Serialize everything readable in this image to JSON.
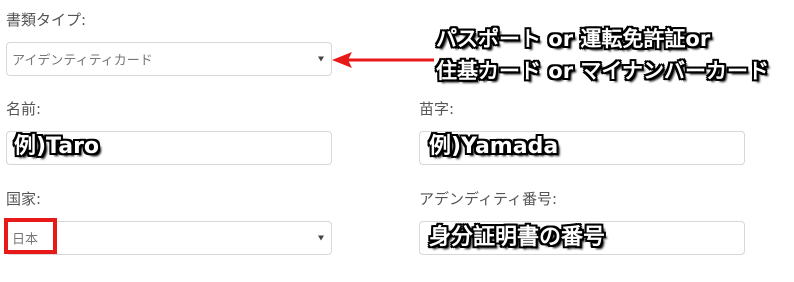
{
  "form": {
    "doc_type": {
      "label": "書類タイプ:",
      "selected": "アイデンティティカード"
    },
    "first_name": {
      "label": "名前:",
      "example": "例)Taro"
    },
    "last_name": {
      "label": "苗字:",
      "example": "例)Yamada"
    },
    "country": {
      "label": "国家:",
      "selected": "日本"
    },
    "id_number": {
      "label": "アデンディティ番号:",
      "example": "身分証明書の番号"
    }
  },
  "annotations": {
    "doc_type_note_line1": "パスポート or 運転免許証or",
    "doc_type_note_line2": "住基カード or マイナンバーカード"
  },
  "colors": {
    "annotation_highlight": "#e81919",
    "arrow": "#e81919"
  },
  "icons": {
    "select_caret": "caret-down-icon",
    "arrow": "left-arrow-icon"
  }
}
